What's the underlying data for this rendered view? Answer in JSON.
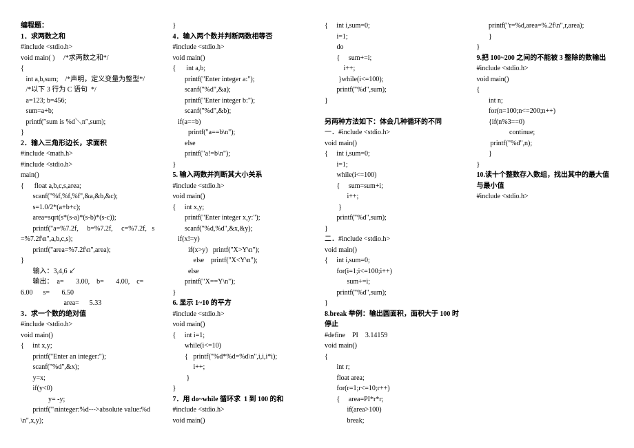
{
  "lines": [
    {
      "t": "编程题：",
      "b": true
    },
    {
      "t": "1．求两数之和",
      "b": true
    },
    {
      "t": "#include <stdio.h>"
    },
    {
      "t": "void main( )     /*求两数之和*/"
    },
    {
      "t": "{"
    },
    {
      "t": "   int a,b,sum;    /*声明，定义变量为整型*/"
    },
    {
      "t": "   /*以下 3 行为 C 语句  */"
    },
    {
      "t": "   a=123; b=456;"
    },
    {
      "t": "   sum=a+b;"
    },
    {
      "t": "   printf(″sum is %d＼n″,sum);"
    },
    {
      "t": "}"
    },
    {
      "t": "2．输入三角形边长，求面积",
      "b": true
    },
    {
      "t": "#include <math.h>"
    },
    {
      "t": "#include <stdio.h>"
    },
    {
      "t": "main()"
    },
    {
      "t": "{      float a,b,c,s,area;"
    },
    {
      "t": "       scanf(\"%f,%f,%f\",&a,&b,&c);"
    },
    {
      "t": "       s=1.0/2*(a+b+c);"
    },
    {
      "t": "       area=sqrt(s*(s-a)*(s-b)*(s-c));"
    },
    {
      "t": "       printf(\"a=%7.2f,     b=%7.2f,     c=%7.2f,   s=%7.2f\\n\",a,b,c,s);"
    },
    {
      "t": "       printf(\"area=%7.2f\\n\",area);"
    },
    {
      "t": "}"
    },
    {
      "t": "       输入：3,4,6 ↙"
    },
    {
      "t": "       输出：  a=       3.00,    b=       4.00,    c=       6.00      s=       6.50"
    },
    {
      "t": "                         area=      5.33"
    },
    {
      "t": "3．求一个数的绝对值",
      "b": true
    },
    {
      "t": "#include <stdio.h>"
    },
    {
      "t": "void main()"
    },
    {
      "t": "{     int x,y;"
    },
    {
      "t": "       printf(\"Enter an integer:\");"
    },
    {
      "t": "       scanf(\"%d\",&x);"
    },
    {
      "t": "       y=x;"
    },
    {
      "t": "       if(y<0)"
    },
    {
      "t": "                y= -y;"
    },
    {
      "t": "       printf(\"\\ninteger:%d--->absolute value:%d\\n\",x,y);"
    },
    {
      "t": "}"
    },
    {
      "t": "4．输入两个数并判断两数相等否",
      "b": true
    },
    {
      "t": "#include <stdio.h>"
    },
    {
      "t": "void main()"
    },
    {
      "t": "{      int a,b;"
    },
    {
      "t": "       printf(\"Enter integer a:\");"
    },
    {
      "t": "       scanf(\"%d\",&a);"
    },
    {
      "t": "       printf(\"Enter integer b:\");"
    },
    {
      "t": "       scanf(\"%d\",&b);"
    },
    {
      "t": "   if(a==b)"
    },
    {
      "t": "         printf(\"a==b\\n\");"
    },
    {
      "t": "       else"
    },
    {
      "t": "       printf(\"a!=b\\n\");"
    },
    {
      "t": "}"
    },
    {
      "t": "5. 输入两数并判断其大小关系",
      "b": true
    },
    {
      "t": "#include <stdio.h>"
    },
    {
      "t": "void main()"
    },
    {
      "t": "{     int x,y;"
    },
    {
      "t": "       printf(\"Enter integer x,y:\");"
    },
    {
      "t": "       scanf(\"%d,%d\",&x,&y);"
    },
    {
      "t": "   if(x!=y)"
    },
    {
      "t": "         if(x>y)   printf(\"X>Y\\n\");"
    },
    {
      "t": "            else    printf(\"X<Y\\n\");"
    },
    {
      "t": "         else"
    },
    {
      "t": "       printf(\"X==Y\\n\");"
    },
    {
      "t": "}"
    },
    {
      "t": "6. 显示 1~10 的平方",
      "b": true
    },
    {
      "t": "#include <stdio.h>"
    },
    {
      "t": "void main()"
    },
    {
      "t": "{     int i=1;"
    },
    {
      "t": "       while(i<=10)"
    },
    {
      "t": "       {   printf(\"%d*%d=%d\\n\",i,i,i*i);"
    },
    {
      "t": "            i++;"
    },
    {
      "t": "        }"
    },
    {
      "t": "}"
    },
    {
      "t": "7．用 do~while 循环求  1 到 100 的和",
      "b": true
    },
    {
      "t": "#include <stdio.h>"
    },
    {
      "t": "void main()"
    },
    {
      "t": "{     int i,sum=0;"
    },
    {
      "t": "       i=1;"
    },
    {
      "t": "       do"
    },
    {
      "t": "       {     sum+=i;"
    },
    {
      "t": "           i++;"
    },
    {
      "t": "        }while(i<=100);"
    },
    {
      "t": "       printf(\"%d\",sum);"
    },
    {
      "t": "}"
    },
    {
      "t": " "
    },
    {
      "t": "另两种方法如下：体会几种循环的不同",
      "b": true
    },
    {
      "t": "一．#include <stdio.h>"
    },
    {
      "t": "void main()"
    },
    {
      "t": "{     int i,sum=0;"
    },
    {
      "t": "       i=1;"
    },
    {
      "t": "       while(i<=100)"
    },
    {
      "t": "       {     sum=sum+i;"
    },
    {
      "t": "             i++;"
    },
    {
      "t": "        }"
    },
    {
      "t": "       printf(\"%d\",sum);"
    },
    {
      "t": "}"
    },
    {
      "t": "二．#include <stdio.h>"
    },
    {
      "t": "void main()"
    },
    {
      "t": "{     int i,sum=0;"
    },
    {
      "t": "       for(i=1;i<=100;i++)"
    },
    {
      "t": "             sum+=i;"
    },
    {
      "t": "       printf(\"%d\",sum);"
    },
    {
      "t": "}"
    },
    {
      "t": "8.break 举例：输出圆面积，面积大于 100 时停止",
      "b": true
    },
    {
      "t": "#define    PI    3.14159"
    },
    {
      "t": "void main()"
    },
    {
      "t": "{"
    },
    {
      "t": "       int r;"
    },
    {
      "t": "       float area;"
    },
    {
      "t": "       for(r=1;r<=10;r++)"
    },
    {
      "t": "       {     area=PI*r*r;"
    },
    {
      "t": "             if(area>100)"
    },
    {
      "t": "             break;"
    },
    {
      "t": "       printf(\"r=%d,area=%.2f\\n\",r,area);"
    },
    {
      "t": "       }"
    },
    {
      "t": "}"
    },
    {
      "t": "9.把 100~200 之间的不能被 3 整除的数输出",
      "b": true
    },
    {
      "t": "#include <stdio.h>"
    },
    {
      "t": "void main()"
    },
    {
      "t": "{"
    },
    {
      "t": "       int n;"
    },
    {
      "t": "       for(n=100;n<=200;n++)"
    },
    {
      "t": "       {if(n%3==0)"
    },
    {
      "t": "                   continue;"
    },
    {
      "t": "        printf(\"%d\",n);"
    },
    {
      "t": "       }"
    },
    {
      "t": "}"
    },
    {
      "t": "10.读十个整数存入数组，找出其中的最大值与最小值",
      "b": true
    },
    {
      "t": "#include <stdio.h>"
    }
  ]
}
